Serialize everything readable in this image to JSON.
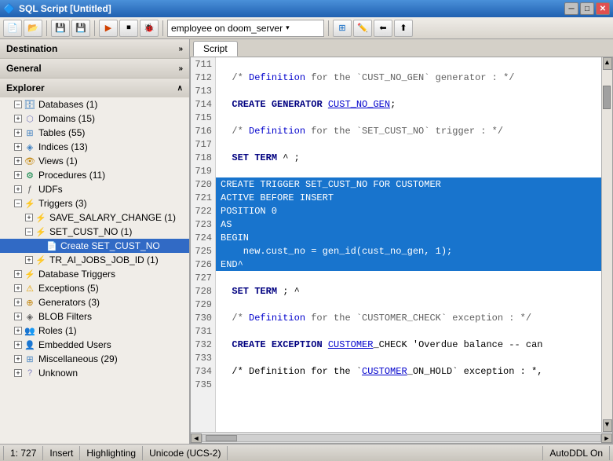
{
  "titleBar": {
    "title": "SQL Script [Untitled]",
    "icon": "🔷",
    "buttons": [
      "─",
      "□",
      "✕"
    ]
  },
  "toolbar": {
    "dropdown": {
      "value": "employee on doom_server",
      "placeholder": "employee on doom_server"
    }
  },
  "leftPanel": {
    "destination": "Destination",
    "general": "General",
    "explorer": "Explorer",
    "treeItems": [
      {
        "id": "databases",
        "label": "Databases (1)",
        "level": 1,
        "expanded": true,
        "icon": "db"
      },
      {
        "id": "domains",
        "label": "Domains (15)",
        "level": 1,
        "expanded": false,
        "icon": "domain"
      },
      {
        "id": "tables",
        "label": "Tables (55)",
        "level": 1,
        "expanded": false,
        "icon": "table"
      },
      {
        "id": "indices",
        "label": "Indices (13)",
        "level": 1,
        "expanded": false,
        "icon": "index"
      },
      {
        "id": "views",
        "label": "Views (1)",
        "level": 1,
        "expanded": false,
        "icon": "view"
      },
      {
        "id": "procedures",
        "label": "Procedures (11)",
        "level": 1,
        "expanded": false,
        "icon": "proc"
      },
      {
        "id": "udfs",
        "label": "UDFs",
        "level": 1,
        "expanded": false,
        "icon": "udf"
      },
      {
        "id": "triggers",
        "label": "Triggers (3)",
        "level": 1,
        "expanded": true,
        "icon": "trigger"
      },
      {
        "id": "save_salary",
        "label": "SAVE_SALARY_CHANGE (1)",
        "level": 2,
        "expanded": false,
        "icon": "trigger"
      },
      {
        "id": "set_cust_no",
        "label": "SET_CUST_NO (1)",
        "level": 2,
        "expanded": true,
        "icon": "trigger"
      },
      {
        "id": "create_set_cust_no",
        "label": "Create SET_CUST_NO",
        "level": 3,
        "expanded": false,
        "selected": true,
        "icon": "item"
      },
      {
        "id": "tr_ai_jobs",
        "label": "TR_AI_JOBS_JOB_ID (1)",
        "level": 2,
        "expanded": false,
        "icon": "trigger"
      },
      {
        "id": "db_triggers",
        "label": "Database Triggers",
        "level": 1,
        "expanded": false,
        "icon": "dbtrig"
      },
      {
        "id": "exceptions",
        "label": "Exceptions (5)",
        "level": 1,
        "expanded": false,
        "icon": "exception"
      },
      {
        "id": "generators",
        "label": "Generators (3)",
        "level": 1,
        "expanded": false,
        "icon": "generator"
      },
      {
        "id": "blob_filters",
        "label": "BLOB Filters",
        "level": 1,
        "expanded": false,
        "icon": "blob"
      },
      {
        "id": "roles",
        "label": "Roles (1)",
        "level": 1,
        "expanded": false,
        "icon": "role"
      },
      {
        "id": "embedded_users",
        "label": "Embedded Users",
        "level": 1,
        "expanded": false,
        "icon": "user"
      },
      {
        "id": "miscellaneous",
        "label": "Miscellaneous (29)",
        "level": 1,
        "expanded": false,
        "icon": "misc"
      },
      {
        "id": "unknown",
        "label": "Unknown",
        "level": 1,
        "expanded": false,
        "icon": "unknown"
      }
    ]
  },
  "codeTab": {
    "label": "Script"
  },
  "codeLines": [
    {
      "num": "711",
      "text": "",
      "highlighted": false
    },
    {
      "num": "712",
      "text": "  /* Definition for the `CUST_NO_GEN` generator : */",
      "highlighted": false,
      "isComment": true
    },
    {
      "num": "713",
      "text": "",
      "highlighted": false
    },
    {
      "num": "714",
      "text": "  CREATE GENERATOR CUST_NO_GEN;",
      "highlighted": false
    },
    {
      "num": "715",
      "text": "",
      "highlighted": false
    },
    {
      "num": "716",
      "text": "  /* Definition for the `SET_CUST_NO` trigger : */",
      "highlighted": false,
      "isComment": true
    },
    {
      "num": "717",
      "text": "",
      "highlighted": false
    },
    {
      "num": "718",
      "text": "  SET TERM ^ ;",
      "highlighted": false
    },
    {
      "num": "719",
      "text": "",
      "highlighted": false
    },
    {
      "num": "720",
      "text": "CREATE TRIGGER SET_CUST_NO FOR CUSTOMER",
      "highlighted": true
    },
    {
      "num": "721",
      "text": "ACTIVE BEFORE INSERT",
      "highlighted": true
    },
    {
      "num": "722",
      "text": "POSITION 0",
      "highlighted": true
    },
    {
      "num": "723",
      "text": "AS",
      "highlighted": true
    },
    {
      "num": "724",
      "text": "BEGIN",
      "highlighted": true
    },
    {
      "num": "725",
      "text": "    new.cust_no = gen_id(cust_no_gen, 1);",
      "highlighted": true
    },
    {
      "num": "726",
      "text": "END^",
      "highlighted": true
    },
    {
      "num": "727",
      "text": "",
      "highlighted": false
    },
    {
      "num": "728",
      "text": "  SET TERM ; ^",
      "highlighted": false
    },
    {
      "num": "729",
      "text": "",
      "highlighted": false
    },
    {
      "num": "730",
      "text": "  /* Definition for the `CUSTOMER_CHECK` exception : */",
      "highlighted": false,
      "isComment": true
    },
    {
      "num": "731",
      "text": "",
      "highlighted": false
    },
    {
      "num": "732",
      "text": "  CREATE EXCEPTION CUSTOMER_CHECK 'Overdue balance -- can",
      "highlighted": false
    },
    {
      "num": "733",
      "text": "",
      "highlighted": false
    },
    {
      "num": "734",
      "text": "  /* Definition for the `CUSTOMER_ON_HOLD` exception : *,",
      "highlighted": false,
      "isComment": true
    },
    {
      "num": "735",
      "text": "",
      "highlighted": false
    }
  ],
  "statusBar": {
    "position": "1: 727",
    "mode": "Insert",
    "highlighting": "Highlighting",
    "encoding": "Unicode (UCS-2)",
    "autoDdl": "AutoDDL On"
  }
}
